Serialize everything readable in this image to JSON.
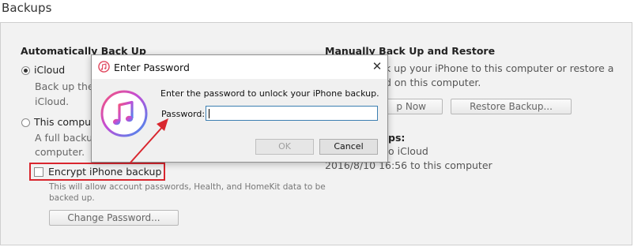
{
  "page": {
    "section_title": "Backups"
  },
  "auto_backup": {
    "heading": "Automatically Back Up",
    "icloud_label": "iCloud",
    "icloud_desc_1": "Back up the",
    "icloud_desc_2": "iCloud.",
    "computer_label": "This compu",
    "computer_desc_1": "A full backu",
    "computer_desc_2": "computer.",
    "encrypt_label": "Encrypt iPhone backup",
    "encrypt_note_1": "This will allow account passwords, Health, and HomeKit data to be",
    "encrypt_note_2": "backed up.",
    "change_password_button": "Change Password..."
  },
  "manual_backup": {
    "heading": "Manually Back Up and Restore",
    "desc_1": "k up your iPhone to this computer or restore a",
    "desc_2": "d on this computer.",
    "backup_now_button": "p Now",
    "restore_button": "Restore Backup...",
    "latest_heading": "ps:",
    "latest_1": "o iCloud",
    "latest_2": "2016/8/10 16:56 to this computer"
  },
  "dialog": {
    "title": "Enter Password",
    "message": "Enter the password to unlock your iPhone backup.",
    "password_label": "Password:",
    "password_value": "",
    "ok_button": "OK",
    "cancel_button": "Cancel",
    "close_glyph": "✕"
  },
  "icons": {
    "itunes": "itunes-icon",
    "itunes_small": "itunes-small-icon",
    "arrow": "annotation-arrow"
  },
  "colors": {
    "annotation_red": "#d9262e",
    "input_border": "#3c7fb1",
    "panel_bg": "#f2f2f2"
  }
}
